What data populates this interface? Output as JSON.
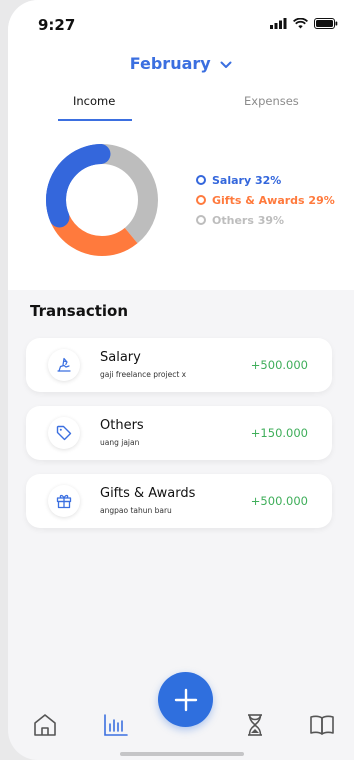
{
  "status": {
    "time": "9:27"
  },
  "header": {
    "month": "February"
  },
  "tabs": [
    {
      "label": "Income",
      "active": true
    },
    {
      "label": "Expenses",
      "active": false
    }
  ],
  "chart_data": {
    "type": "pie",
    "categories": [
      "Salary",
      "Gifts & Awards",
      "Others"
    ],
    "values": [
      32,
      29,
      39
    ],
    "colors": [
      "#3467dc",
      "#ff7a3d",
      "#bdbdbd"
    ],
    "legend_labels": [
      "Salary 32%",
      "Gifts & Awards 29%",
      "Others 39%"
    ],
    "legend": "right"
  },
  "transactions": {
    "title": "Transaction",
    "items": [
      {
        "title": "Salary",
        "subtitle": "gaji freelance project x",
        "amount": "+500.000",
        "icon": "money-hand-icon"
      },
      {
        "title": "Others",
        "subtitle": "uang jajan",
        "amount": "+150.000",
        "icon": "tag-icon"
      },
      {
        "title": "Gifts & Awards",
        "subtitle": "angpao tahun baru",
        "amount": "+500.000",
        "icon": "gift-icon"
      }
    ]
  },
  "colors": {
    "accent": "#3b6fe0",
    "positive": "#3fae5a"
  },
  "nav": {
    "items": [
      "home-icon",
      "chart-icon",
      "add-icon",
      "hourglass-icon",
      "book-icon"
    ]
  }
}
